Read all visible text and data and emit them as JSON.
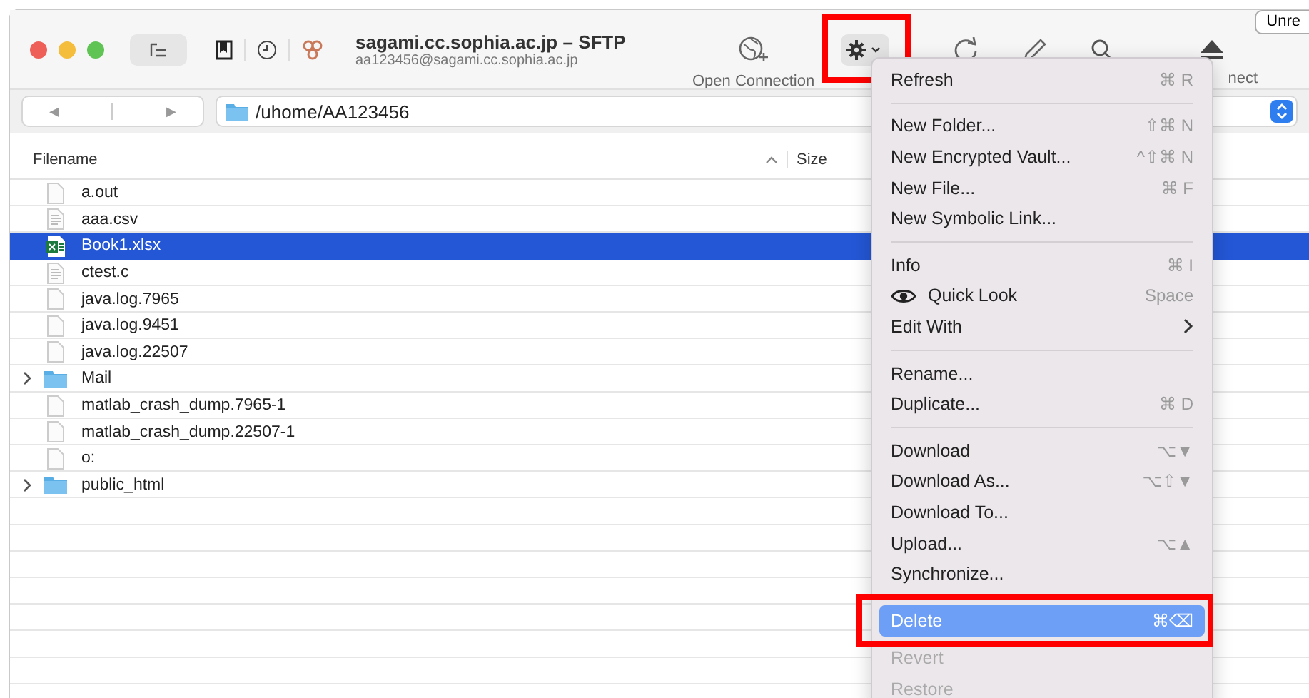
{
  "window": {
    "title": "sagami.cc.sophia.ac.jp – SFTP",
    "subtitle": "aa123456@sagami.cc.sophia.ac.jp"
  },
  "toolbar": {
    "open_connection_label": "Open Connection",
    "disconnect_label": "nect",
    "top_right_button": "Unre"
  },
  "path_bar": {
    "back_glyph": "◀",
    "forward_glyph": "▶",
    "path": "/uhome/AA123456"
  },
  "table": {
    "columns": [
      {
        "label": "Filename"
      },
      {
        "label": "Size"
      }
    ],
    "rows": [
      {
        "name": "a.out",
        "kind": "file",
        "selected": false
      },
      {
        "name": "aaa.csv",
        "kind": "text",
        "selected": false
      },
      {
        "name": "Book1.xlsx",
        "kind": "excel",
        "selected": true
      },
      {
        "name": "ctest.c",
        "kind": "text",
        "selected": false
      },
      {
        "name": "java.log.7965",
        "kind": "file",
        "selected": false
      },
      {
        "name": "java.log.9451",
        "kind": "file",
        "selected": false
      },
      {
        "name": "java.log.22507",
        "kind": "file",
        "selected": false
      },
      {
        "name": "Mail",
        "kind": "folder",
        "selected": false,
        "expanded": false
      },
      {
        "name": "matlab_crash_dump.7965-1",
        "kind": "file",
        "selected": false
      },
      {
        "name": "matlab_crash_dump.22507-1",
        "kind": "file",
        "selected": false
      },
      {
        "name": "o:",
        "kind": "file",
        "selected": false
      },
      {
        "name": "public_html",
        "kind": "folder",
        "selected": false,
        "expanded": false
      }
    ]
  },
  "menu": {
    "items": [
      {
        "kind": "item",
        "label": "Refresh",
        "shortcut": "⌘ R",
        "disabled": false,
        "selected": false
      },
      {
        "kind": "separator"
      },
      {
        "kind": "item",
        "label": "New Folder...",
        "shortcut": "⇧⌘ N",
        "disabled": false,
        "selected": false
      },
      {
        "kind": "item",
        "label": "New Encrypted Vault...",
        "shortcut": "^⇧⌘ N",
        "disabled": false,
        "selected": false
      },
      {
        "kind": "item",
        "label": "New File...",
        "shortcut": "⌘ F",
        "disabled": false,
        "selected": false
      },
      {
        "kind": "item",
        "label": "New Symbolic Link...",
        "disabled": false,
        "selected": false
      },
      {
        "kind": "separator"
      },
      {
        "kind": "item",
        "label": "Info",
        "shortcut": "⌘ I",
        "disabled": false,
        "selected": false
      },
      {
        "kind": "eye",
        "label": "Quick Look",
        "shortcut": "Space",
        "disabled": false,
        "selected": false
      },
      {
        "kind": "submenu",
        "label": "Edit With",
        "disabled": false,
        "selected": false
      },
      {
        "kind": "separator"
      },
      {
        "kind": "item",
        "label": "Rename...",
        "disabled": false,
        "selected": false
      },
      {
        "kind": "item",
        "label": "Duplicate...",
        "shortcut": "⌘ D",
        "disabled": false,
        "selected": false
      },
      {
        "kind": "separator"
      },
      {
        "kind": "item",
        "label": "Download",
        "shortcut": "⌥▼",
        "disabled": false,
        "selected": false
      },
      {
        "kind": "item",
        "label": "Download As...",
        "shortcut": "⌥⇧▼",
        "disabled": false,
        "selected": false
      },
      {
        "kind": "item",
        "label": "Download To...",
        "disabled": false,
        "selected": false
      },
      {
        "kind": "item",
        "label": "Upload...",
        "shortcut": "⌥▲",
        "disabled": false,
        "selected": false
      },
      {
        "kind": "item",
        "label": "Synchronize...",
        "disabled": false,
        "selected": false
      },
      {
        "kind": "separator"
      },
      {
        "kind": "item",
        "label": "Delete",
        "shortcut": "⌘⌫",
        "disabled": false,
        "selected": true
      },
      {
        "kind": "item",
        "label": "Revert",
        "disabled": true,
        "selected": false
      },
      {
        "kind": "item",
        "label": "Restore",
        "disabled": true,
        "selected": false
      }
    ]
  }
}
